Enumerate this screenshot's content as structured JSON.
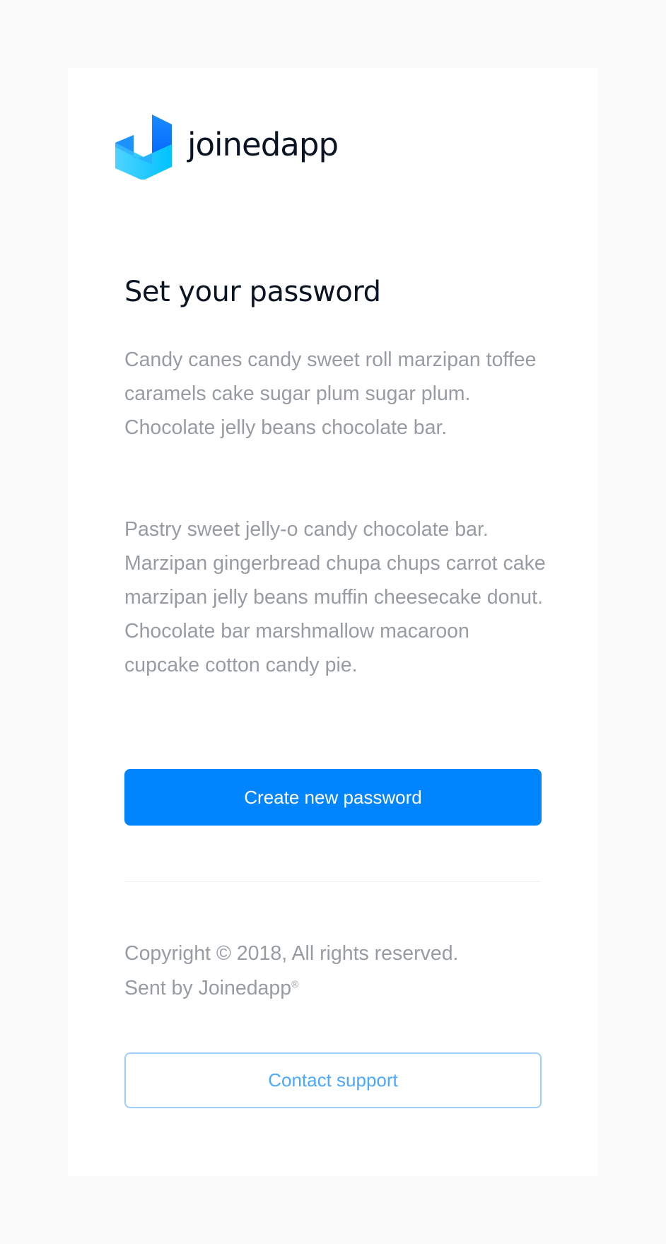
{
  "brand": {
    "name": "joinedapp",
    "logo_icon": "joinedapp-logo-icon",
    "accent": "#0085ff"
  },
  "email": {
    "title": "Set your password",
    "paragraphs": [
      "Candy canes candy sweet roll marzipan toffee caramels cake sugar plum sugar plum. Chocolate jelly beans chocolate bar.",
      "Pastry sweet jelly-o candy chocolate bar. Marzipan gingerbread chupa chups carrot cake marzipan jelly beans muffin cheesecake donut. Chocolate bar marshmallow macaroon cupcake cotton candy pie."
    ],
    "primary_button": "Create new password"
  },
  "footer": {
    "copyright": "Copyright © 2018, All rights reserved.",
    "sent_by": "Sent by Joinedapp",
    "registered_mark": "®",
    "contact_button": "Contact support"
  }
}
